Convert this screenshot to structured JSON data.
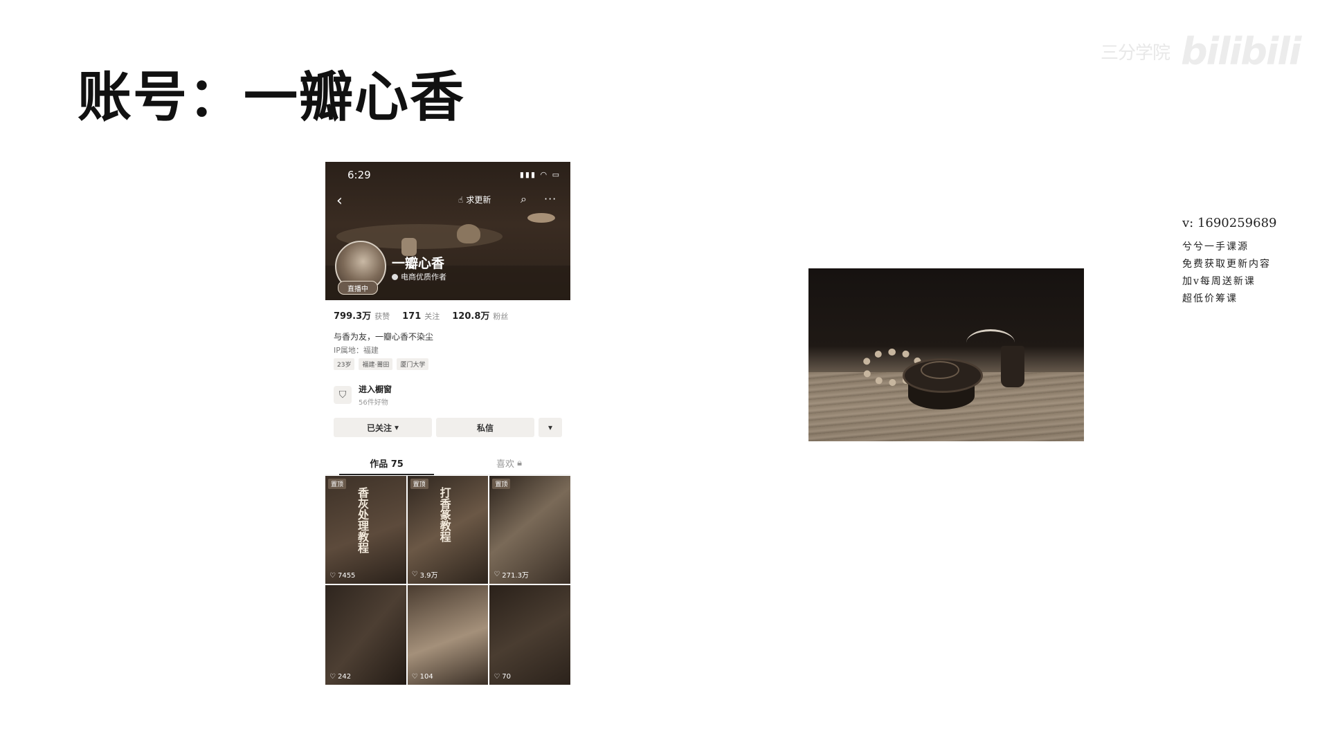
{
  "slide": {
    "title": "账号：一瓣心香"
  },
  "watermark": {
    "text": "三分学院",
    "logo": "bilibili"
  },
  "phone": {
    "status": {
      "time": "6:29"
    },
    "header": {
      "request_update_label": "求更新"
    },
    "profile": {
      "name": "一瓣心香",
      "role": "电商优质作者",
      "live_badge": "直播中"
    },
    "stats": [
      {
        "value": "799.3万",
        "label": "获赞"
      },
      {
        "value": "171",
        "label": "关注"
      },
      {
        "value": "120.8万",
        "label": "粉丝"
      }
    ],
    "bio": "与香为友，一瓣心香不染尘",
    "ip": "IP属地：福建",
    "tags": [
      "23岁",
      "福建·莆田",
      "厦门大学"
    ],
    "shop": {
      "title": "进入橱窗",
      "subtitle": "56件好物"
    },
    "actions": {
      "follow": "已关注",
      "message": "私信"
    },
    "tabs": {
      "works": "作品 75",
      "likes": "喜欢"
    },
    "grid": [
      {
        "pinned": "置顶",
        "cover_text": "香灰处理教程",
        "likes": "7455"
      },
      {
        "pinned": "置顶",
        "cover_text": "打香篆教程",
        "likes": "3.9万"
      },
      {
        "pinned": "置顶",
        "cover_text": "",
        "likes": "271.3万"
      },
      {
        "pinned": "",
        "cover_text": "",
        "likes": "242"
      },
      {
        "pinned": "",
        "cover_text": "",
        "likes": "104"
      },
      {
        "pinned": "",
        "cover_text": "",
        "likes": "70"
      }
    ]
  },
  "contact": {
    "wechat": "v: 1690259689",
    "lines": [
      "兮兮一手课源",
      "免费获取更新内容",
      "加v每周送新课",
      "超低价筹课"
    ]
  }
}
